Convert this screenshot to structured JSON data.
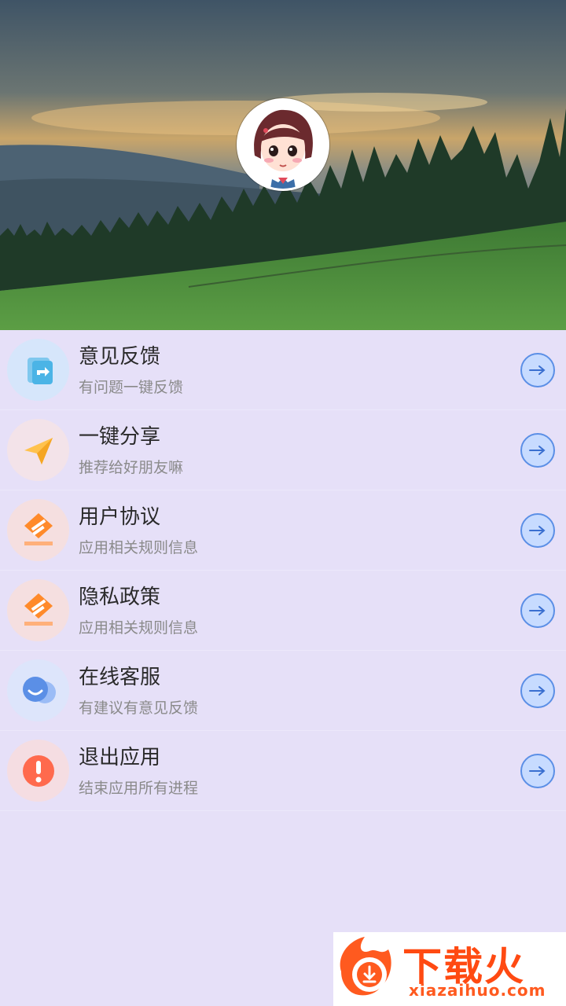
{
  "menu": {
    "items": [
      {
        "title": "意见反馈",
        "subtitle": "有问题一键反馈",
        "icon": "feedback-icon",
        "icon_bg": "#d6e6fb"
      },
      {
        "title": "一键分享",
        "subtitle": "推荐给好朋友嘛",
        "icon": "paper-plane-icon",
        "icon_bg": "#f3e3e9"
      },
      {
        "title": "用户协议",
        "subtitle": "应用相关规则信息",
        "icon": "agreement-icon",
        "icon_bg": "#f5dfe0"
      },
      {
        "title": "隐私政策",
        "subtitle": "应用相关规则信息",
        "icon": "privacy-icon",
        "icon_bg": "#f5dfe0"
      },
      {
        "title": "在线客服",
        "subtitle": "有建议有意见反馈",
        "icon": "customer-service-icon",
        "icon_bg": "#dde5fb"
      },
      {
        "title": "退出应用",
        "subtitle": "结束应用所有进程",
        "icon": "exclamation-icon",
        "icon_bg": "#f5dde2"
      }
    ]
  },
  "watermark": {
    "name": "下载火",
    "url": "xiazaihuo.com"
  },
  "colors": {
    "page_bg": "#e6e0f8",
    "arrow_fill": "#c7dbff",
    "arrow_stroke": "#5b8fe6"
  }
}
